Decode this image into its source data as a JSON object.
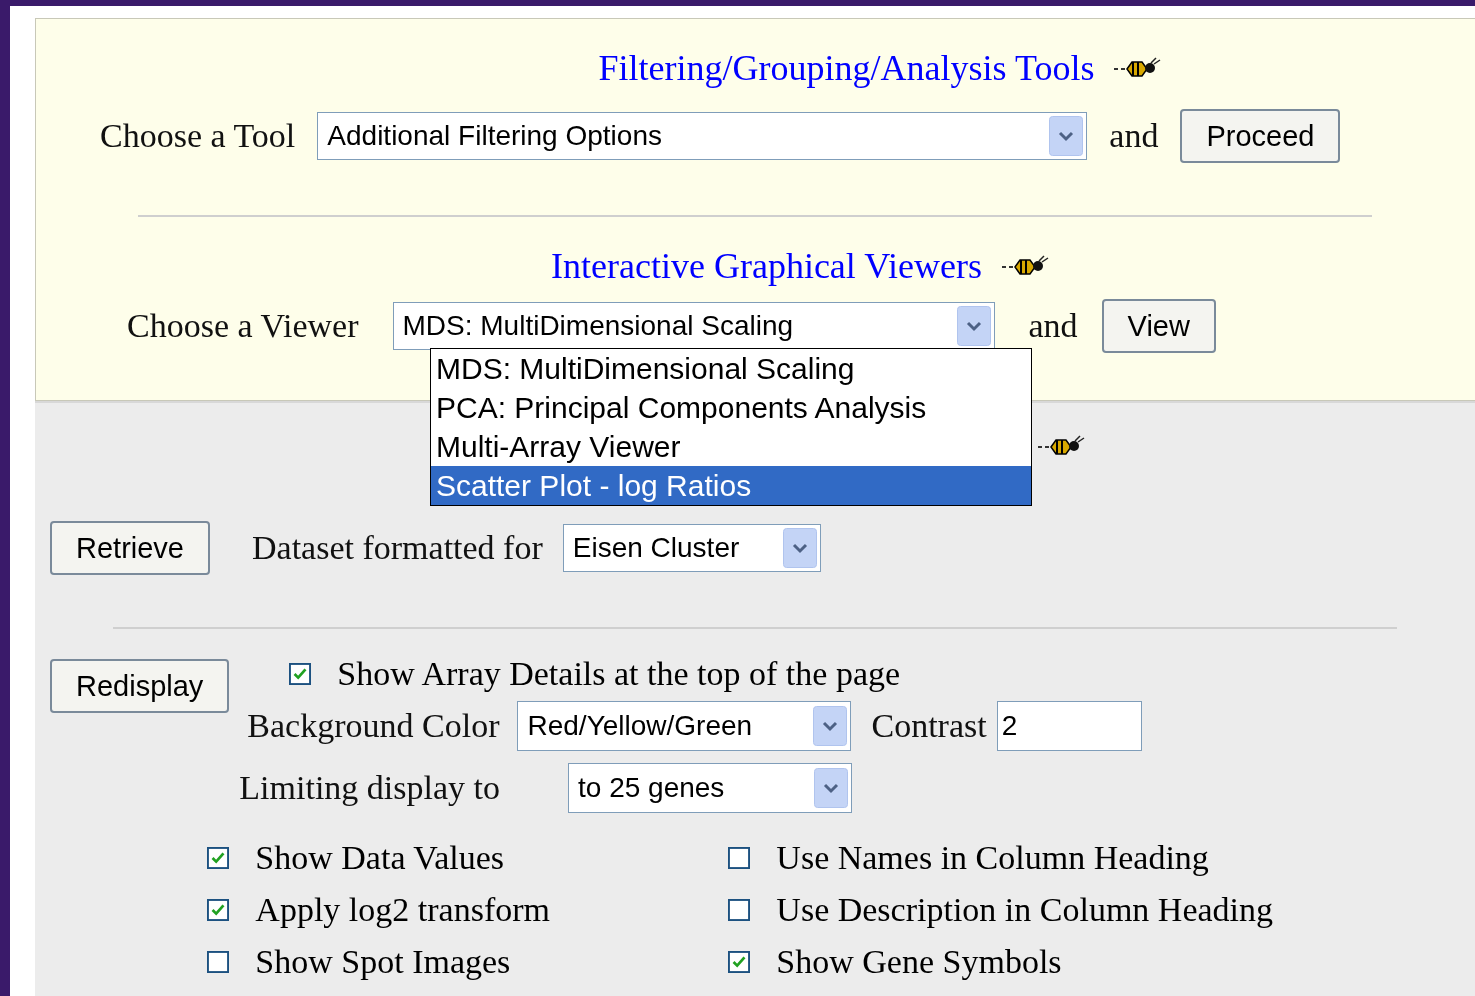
{
  "tools": {
    "title": "Filtering/Grouping/Analysis Tools",
    "label": "Choose a Tool",
    "select": {
      "value": "Additional Filtering Options"
    },
    "connector": "and",
    "button": "Proceed"
  },
  "viewers": {
    "title": "Interactive Graphical Viewers",
    "label": "Choose a Viewer",
    "select": {
      "value": "MDS: MultiDimensional Scaling",
      "expanded": true,
      "options": [
        {
          "label": "MDS: MultiDimensional Scaling",
          "highlighted": false
        },
        {
          "label": "PCA: Principal Components Analysis",
          "highlighted": false
        },
        {
          "label": "Multi-Array Viewer",
          "highlighted": false
        },
        {
          "label": "Scatter Plot - log Ratios",
          "highlighted": true
        }
      ]
    },
    "connector": "and",
    "button": "View"
  },
  "download": {
    "button": "Retrieve",
    "label": "Dataset formatted for",
    "select": {
      "value": "Eisen Cluster"
    }
  },
  "display": {
    "button": "Redisplay",
    "show_details": {
      "label": "Show Array Details at the top of the page",
      "checked": true
    },
    "background": {
      "label": "Background Color",
      "value": "Red/Yellow/Green"
    },
    "contrast": {
      "label": "Contrast",
      "value": "2"
    },
    "limit": {
      "label": "Limiting display to",
      "value": "to 25 genes"
    },
    "options": [
      {
        "label": "Show Data Values",
        "checked": true
      },
      {
        "label": "Use Names in Column Heading",
        "checked": false
      },
      {
        "label": "Apply log2 transform",
        "checked": true
      },
      {
        "label": "Use Description in Column Heading",
        "checked": false
      },
      {
        "label": "Show Spot Images",
        "checked": false
      },
      {
        "label": "Show Gene Symbols",
        "checked": true
      }
    ]
  }
}
